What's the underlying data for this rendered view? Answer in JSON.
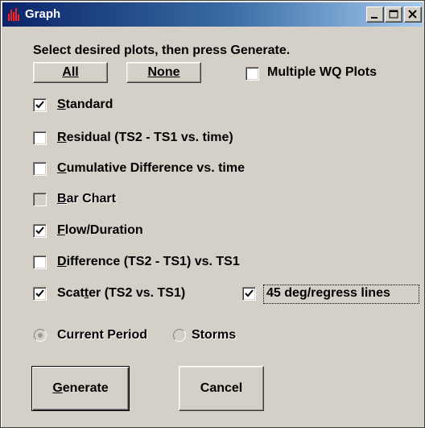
{
  "window": {
    "title": "Graph",
    "minimize": "_",
    "maximize": "□",
    "close": "×"
  },
  "instructions": "Select desired plots, then press Generate.",
  "buttons": {
    "all": "All",
    "none": "None",
    "generate_rest": "enerate",
    "generate_mnemonic": "G",
    "cancel": "Cancel"
  },
  "multiple_wq": {
    "label": "Multiple WQ Plots",
    "checked": false
  },
  "plots": [
    {
      "mn": "S",
      "rest": "tandard",
      "checked": true,
      "enabled": true
    },
    {
      "mn": "R",
      "rest": "esidual (TS2 - TS1 vs. time)",
      "checked": false,
      "enabled": true
    },
    {
      "mn": "C",
      "rest": "umulative Difference vs. time",
      "checked": false,
      "enabled": true
    },
    {
      "mn": "B",
      "rest": "ar Chart",
      "checked": false,
      "enabled": false
    },
    {
      "mn": "F",
      "rest": "low/Duration",
      "checked": true,
      "enabled": true
    },
    {
      "mn": "D",
      "rest": "ifference (TS2 - TS1) vs. TS1",
      "checked": false,
      "enabled": true
    }
  ],
  "scatter": {
    "pre": "Scat",
    "mn": "t",
    "post": "er (TS2  vs. TS1)",
    "checked": true
  },
  "regress": {
    "label": "45 deg/regress lines",
    "checked": true
  },
  "period": {
    "current": "Current Period",
    "storms": "Storms",
    "selected": "current",
    "enabled": false
  },
  "colors": {
    "face": "#d4d0c8",
    "title_start": "#0a246a",
    "title_end": "#a6caf0"
  }
}
